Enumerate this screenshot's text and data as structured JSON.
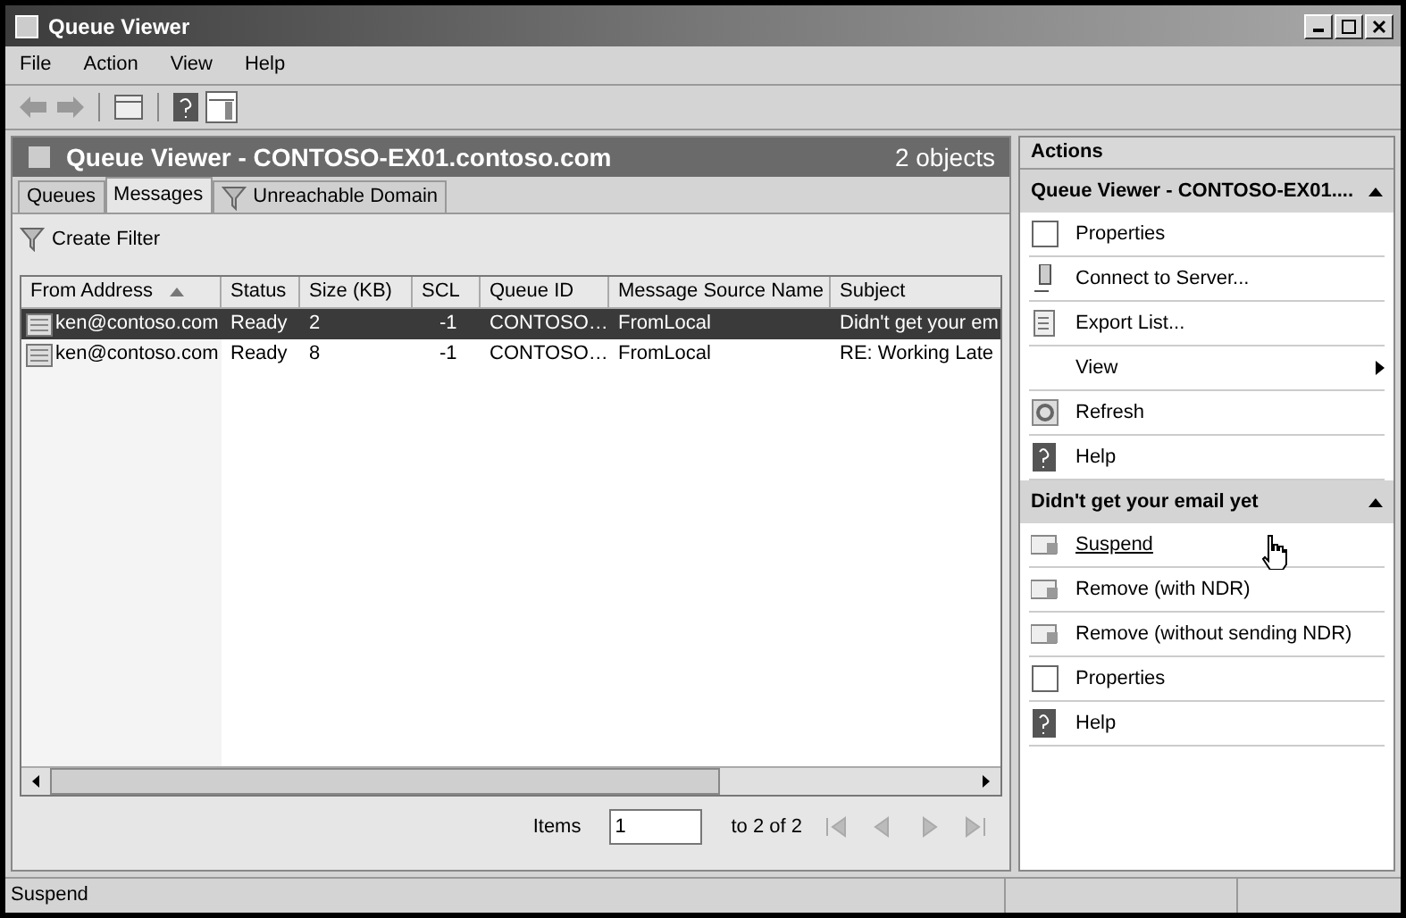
{
  "window": {
    "title": "Queue Viewer"
  },
  "menu": [
    "File",
    "Action",
    "View",
    "Help"
  ],
  "content": {
    "title": "Queue Viewer - CONTOSO-EX01.contoso.com",
    "count": "2 objects",
    "tabs": [
      {
        "label": "Queues",
        "selected": false
      },
      {
        "label": "Messages",
        "selected": true
      },
      {
        "label": "Unreachable Domain",
        "selected": false
      }
    ],
    "create_filter": "Create Filter",
    "table": {
      "columns": [
        {
          "label": "From Address",
          "sorted": true
        },
        {
          "label": "Status",
          "sorted": false
        },
        {
          "label": "Size (KB)",
          "sorted": false
        },
        {
          "label": "SCL",
          "sorted": false
        },
        {
          "label": "Queue ID",
          "sorted": false
        },
        {
          "label": "Message Source Name",
          "sorted": false
        },
        {
          "label": "Subject",
          "sorted": false
        }
      ],
      "rows": [
        {
          "selected": true,
          "cells": [
            "ken@contoso.com",
            "Ready",
            "2",
            "-1",
            "CONTOSO…",
            "FromLocal",
            "Didn't get your em"
          ]
        },
        {
          "selected": false,
          "cells": [
            "ken@contoso.com",
            "Ready",
            "8",
            "-1",
            "CONTOSO…",
            "FromLocal",
            "RE: Working Late"
          ]
        }
      ]
    },
    "pager": {
      "label": "Items",
      "value": "1",
      "range": "to 2 of 2"
    }
  },
  "actions": {
    "title": "Actions",
    "groups": [
      {
        "title": "Queue Viewer - CONTOSO-EX01....",
        "expanded": true,
        "items": [
          {
            "kind": "page",
            "label": "Properties",
            "hovered": false
          },
          {
            "kind": "server",
            "label": "Connect to Server...",
            "hovered": false
          },
          {
            "kind": "export",
            "label": "Export List...",
            "hovered": false
          },
          {
            "kind": "submenu",
            "label": "View",
            "hovered": false
          },
          {
            "kind": "refresh",
            "label": "Refresh",
            "hovered": false
          },
          {
            "kind": "help",
            "label": "Help",
            "hovered": false
          }
        ]
      },
      {
        "title": "Didn't get your email yet",
        "expanded": true,
        "items": [
          {
            "kind": "queue",
            "label": "Suspend",
            "hovered": true
          },
          {
            "kind": "queue",
            "label": "Remove (with NDR)",
            "hovered": false
          },
          {
            "kind": "queue",
            "label": "Remove (without sending NDR)",
            "hovered": false
          },
          {
            "kind": "page",
            "label": "Properties",
            "hovered": false
          },
          {
            "kind": "help",
            "label": "Help",
            "hovered": false
          }
        ]
      }
    ]
  },
  "status_bar": "Suspend"
}
